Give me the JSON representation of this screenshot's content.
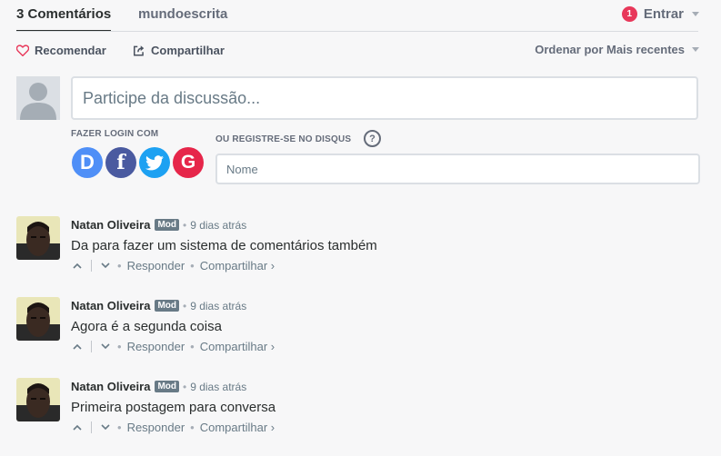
{
  "nav": {
    "comments_tab": "3 Comentários",
    "forum_tab": "mundoescrita",
    "notification_count": "1",
    "login_label": "Entrar"
  },
  "actions": {
    "recommend": "Recomendar",
    "share": "Compartilhar",
    "sort": "Ordenar por Mais recentes"
  },
  "composer": {
    "placeholder": "Participe da discussão...",
    "login_with": "FAZER LOGIN COM",
    "register": "OU REGISTRE-SE NO DISQUS",
    "help": "?",
    "name_placeholder": "Nome"
  },
  "social": [
    {
      "label": "D",
      "color": "#4f8ff7"
    },
    {
      "label": "f",
      "color": "#4a5aa0"
    },
    {
      "label": "t",
      "color": "#1da1f2"
    },
    {
      "label": "G",
      "color": "#e6264a"
    }
  ],
  "comments": [
    {
      "author": "Natan Oliveira",
      "badge": "Mod",
      "time": "9 dias atrás",
      "text": "Da para fazer um sistema de comentários também",
      "reply": "Responder",
      "share": "Compartilhar ›"
    },
    {
      "author": "Natan Oliveira",
      "badge": "Mod",
      "time": "9 dias atrás",
      "text": "Agora é a segunda coisa",
      "reply": "Responder",
      "share": "Compartilhar ›"
    },
    {
      "author": "Natan Oliveira",
      "badge": "Mod",
      "time": "9 dias atrás",
      "text": "Primeira postagem para conversa",
      "reply": "Responder",
      "share": "Compartilhar ›"
    }
  ],
  "dot": "•"
}
